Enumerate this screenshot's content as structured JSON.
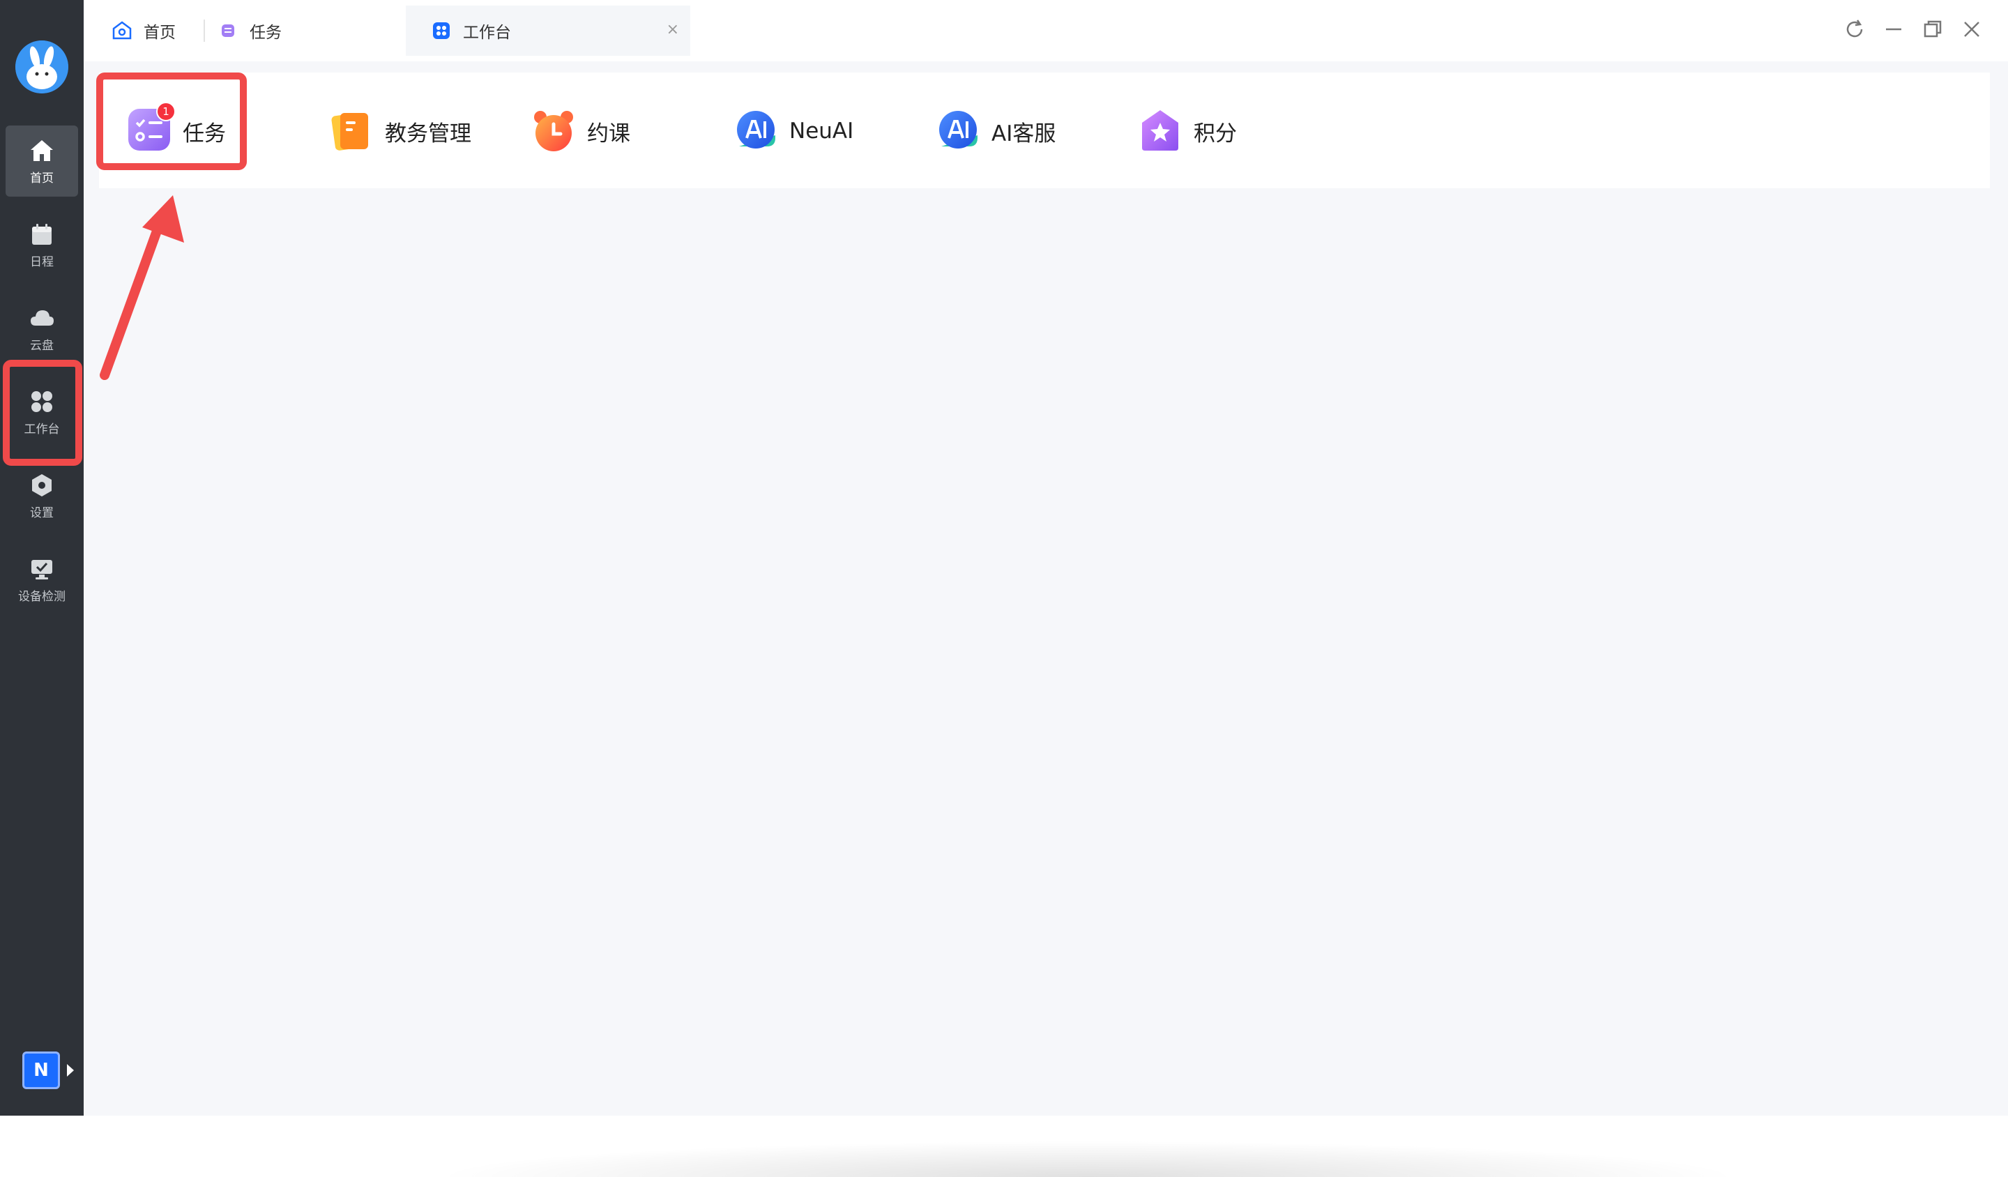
{
  "sidebar": {
    "items": [
      {
        "label": "首页",
        "icon": "home-icon",
        "active": true
      },
      {
        "label": "日程",
        "icon": "calendar-icon",
        "active": false
      },
      {
        "label": "云盘",
        "icon": "cloud-icon",
        "active": false
      },
      {
        "label": "工作台",
        "icon": "grid-icon",
        "active": false
      },
      {
        "label": "设置",
        "icon": "settings-icon",
        "active": false
      },
      {
        "label": "设备检测",
        "icon": "device-check-icon",
        "active": false
      }
    ],
    "bottom_badge": "N"
  },
  "tabs": [
    {
      "label": "首页",
      "icon": "home-tab-icon",
      "closable": false
    },
    {
      "label": "任务",
      "icon": "task-tab-icon",
      "closable": true
    },
    {
      "label": "工作台",
      "icon": "grid-tab-icon",
      "closable": true,
      "active": true
    }
  ],
  "tab_close_glyph": "×",
  "window_controls": [
    "refresh-icon",
    "minimize-icon",
    "restore-icon",
    "close-icon"
  ],
  "apps": [
    {
      "label": "任务",
      "icon": "task-icon",
      "badge": "1"
    },
    {
      "label": "教务管理",
      "icon": "book-icon"
    },
    {
      "label": "约课",
      "icon": "alarm-clock-icon"
    },
    {
      "label": "NeuAI",
      "icon": "ai-icon"
    },
    {
      "label": "AI客服",
      "icon": "ai-service-icon"
    },
    {
      "label": "积分",
      "icon": "points-star-icon"
    }
  ],
  "colors": {
    "sidebar_bg": "#2e3238",
    "annotation_red": "#f04a4a",
    "badge_red": "#f5313d",
    "accent_blue": "#1a6cff"
  }
}
